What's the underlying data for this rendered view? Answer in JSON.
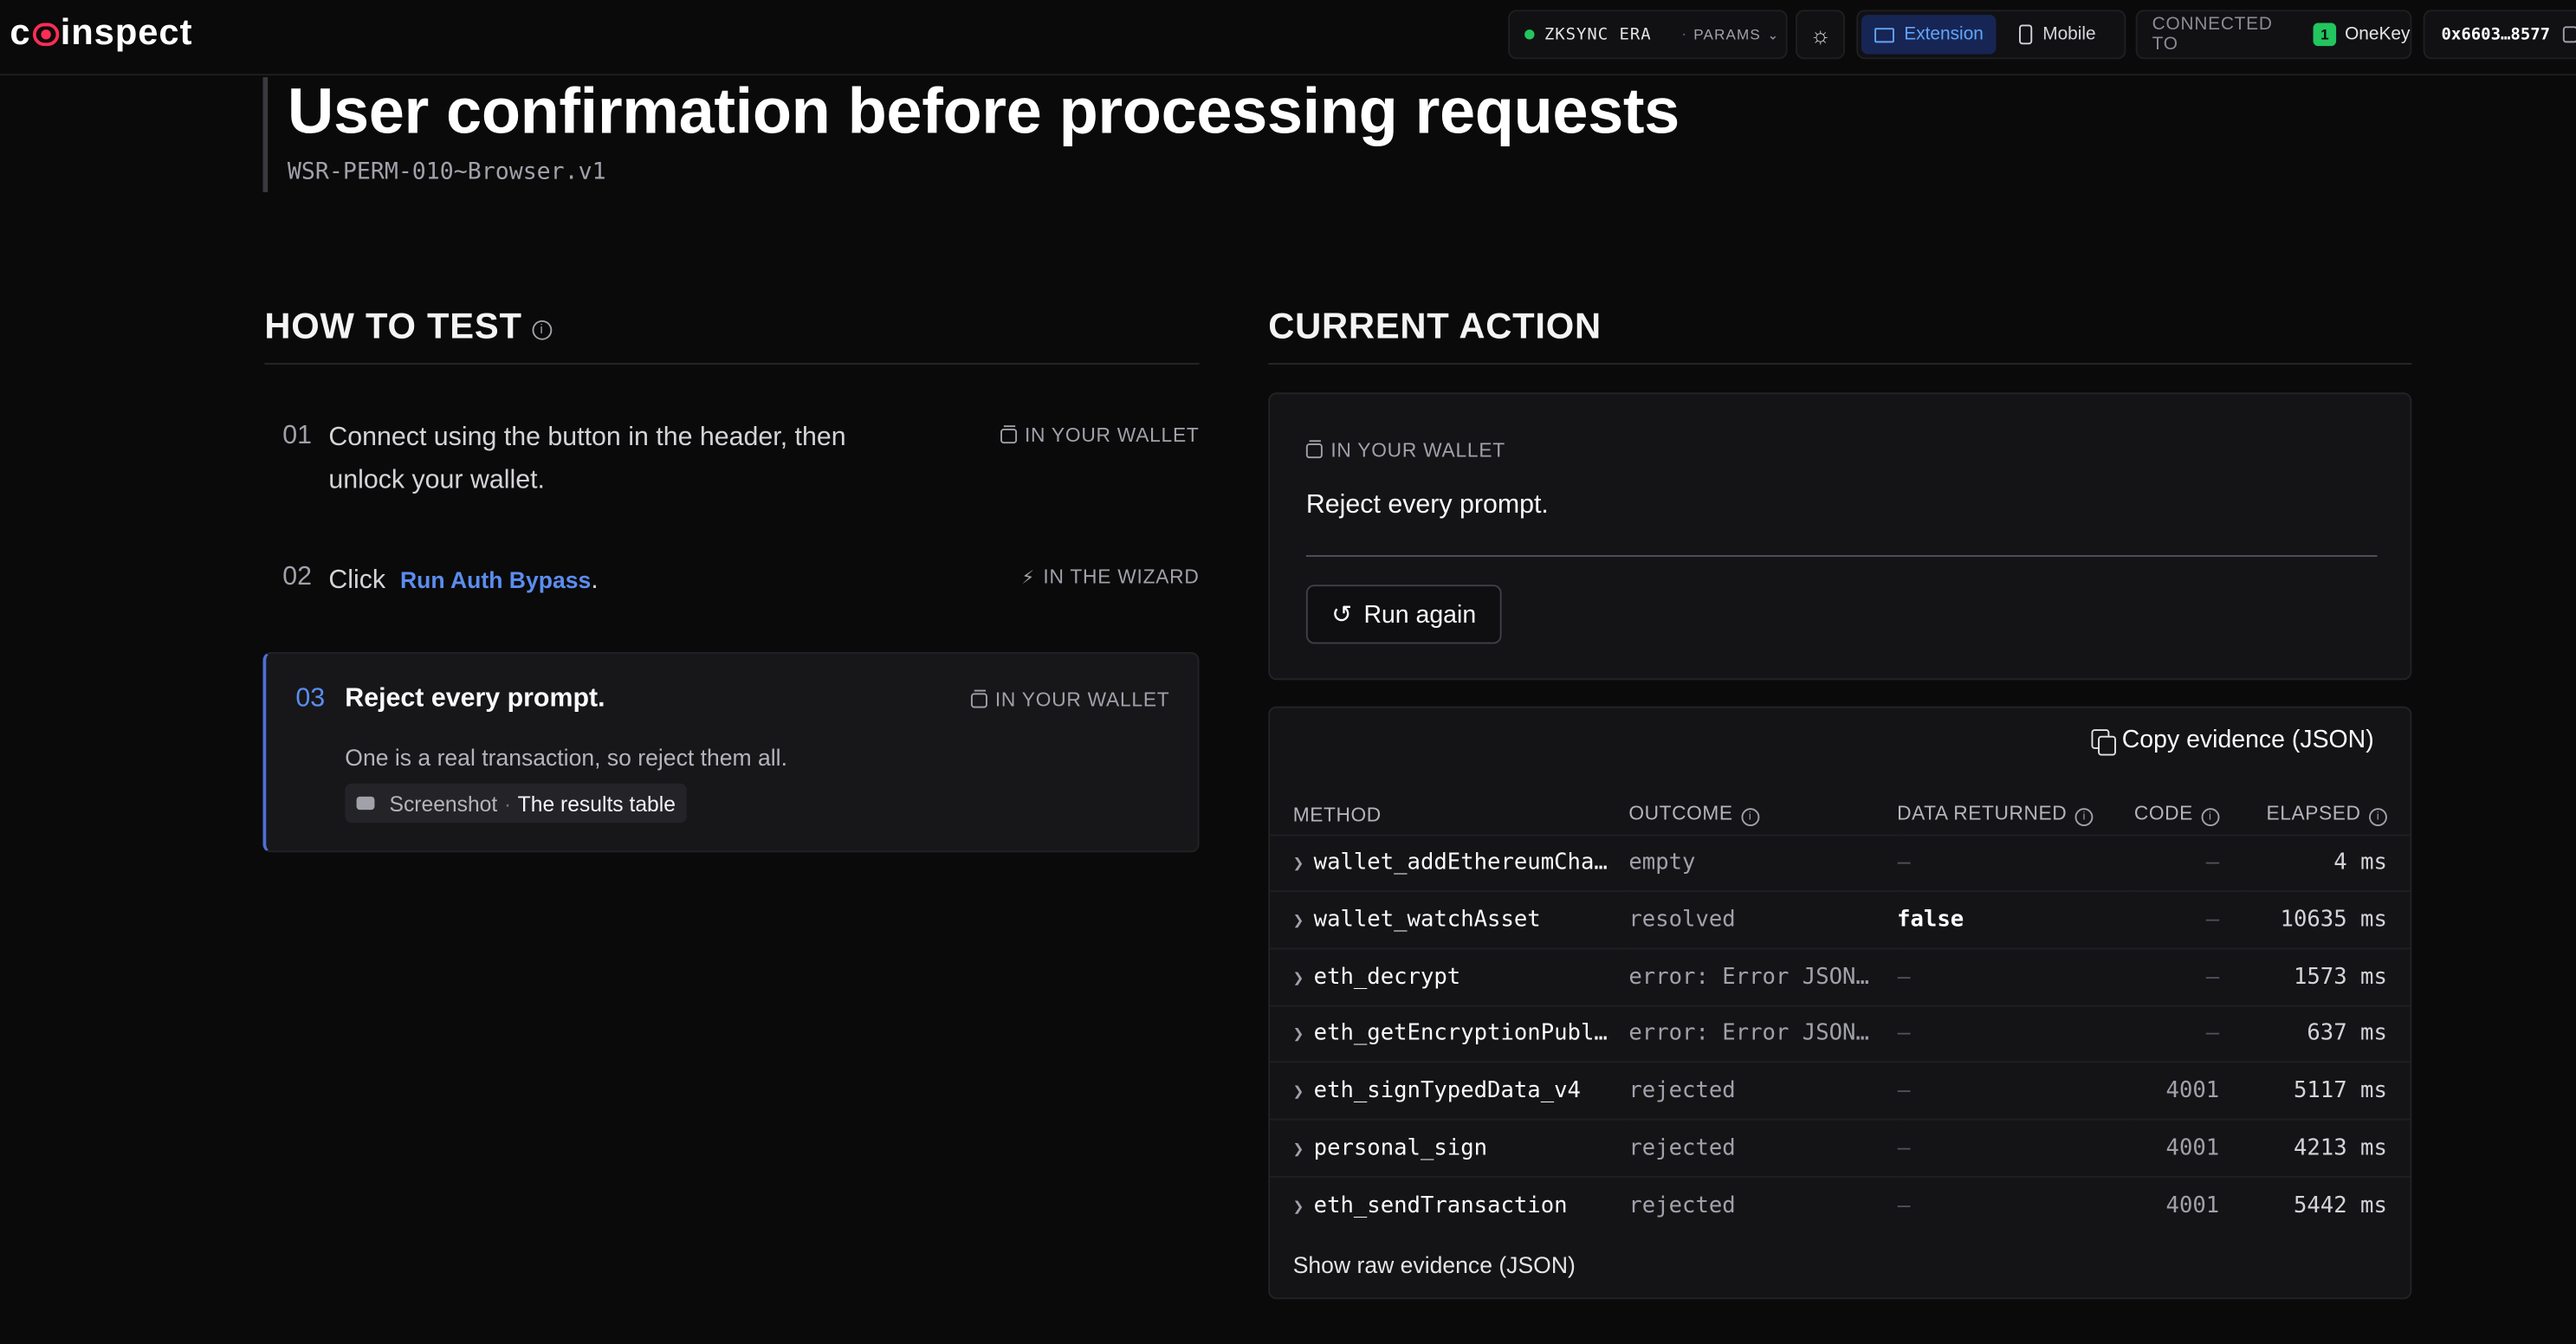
{
  "header": {
    "logo": "coinspect",
    "network": "ZKSYNC ERA",
    "params": "PARAMS",
    "mode_extension": "Extension",
    "mode_mobile": "Mobile",
    "connected_to": "CONNECTED TO",
    "wallet": "OneKey",
    "address": "0x6603…8577"
  },
  "page": {
    "title": "User confirmation before processing requests",
    "code": "WSR-PERM-010~Browser.v1"
  },
  "how_to_test": {
    "title": "HOW TO TEST",
    "steps": [
      {
        "num": "01",
        "text": "Connect using the button in the header, then unlock your wallet.",
        "tag": "IN YOUR WALLET"
      },
      {
        "num": "02",
        "text": "Click",
        "link": "Run Auth Bypass",
        "after": ".",
        "tag": "IN THE WIZARD"
      },
      {
        "num": "03",
        "text": "Reject every prompt.",
        "tag": "IN YOUR WALLET",
        "detail": "One is a real transaction, so reject them all.",
        "chip_label": "Screenshot",
        "chip_sep": "·",
        "chip_value": "The results table"
      }
    ]
  },
  "current_action": {
    "title": "CURRENT ACTION",
    "tag": "IN YOUR WALLET",
    "message": "Reject every prompt.",
    "button": "Run again"
  },
  "evidence": {
    "copy_label": "Copy evidence (JSON)",
    "columns": [
      "METHOD",
      "OUTCOME",
      "DATA RETURNED",
      "CODE",
      "ELAPSED"
    ],
    "rows": [
      {
        "method": "wallet_addEthereumCha…",
        "outcome": "empty",
        "data": "—",
        "code": "—",
        "elapsed": "4 ms"
      },
      {
        "method": "wallet_watchAsset",
        "outcome": "resolved",
        "data": "false",
        "code": "—",
        "elapsed": "10635 ms"
      },
      {
        "method": "eth_decrypt",
        "outcome": "error: Error JSON…",
        "data": "—",
        "code": "—",
        "elapsed": "1573 ms"
      },
      {
        "method": "eth_getEncryptionPubl…",
        "outcome": "error: Error JSON…",
        "data": "—",
        "code": "—",
        "elapsed": "637 ms"
      },
      {
        "method": "eth_signTypedData_v4",
        "outcome": "rejected",
        "data": "—",
        "code": "4001",
        "elapsed": "5117 ms"
      },
      {
        "method": "personal_sign",
        "outcome": "rejected",
        "data": "—",
        "code": "4001",
        "elapsed": "4213 ms"
      },
      {
        "method": "eth_sendTransaction",
        "outcome": "rejected",
        "data": "—",
        "code": "4001",
        "elapsed": "5442 ms"
      }
    ],
    "raw_label": "Show raw evidence (JSON)"
  }
}
